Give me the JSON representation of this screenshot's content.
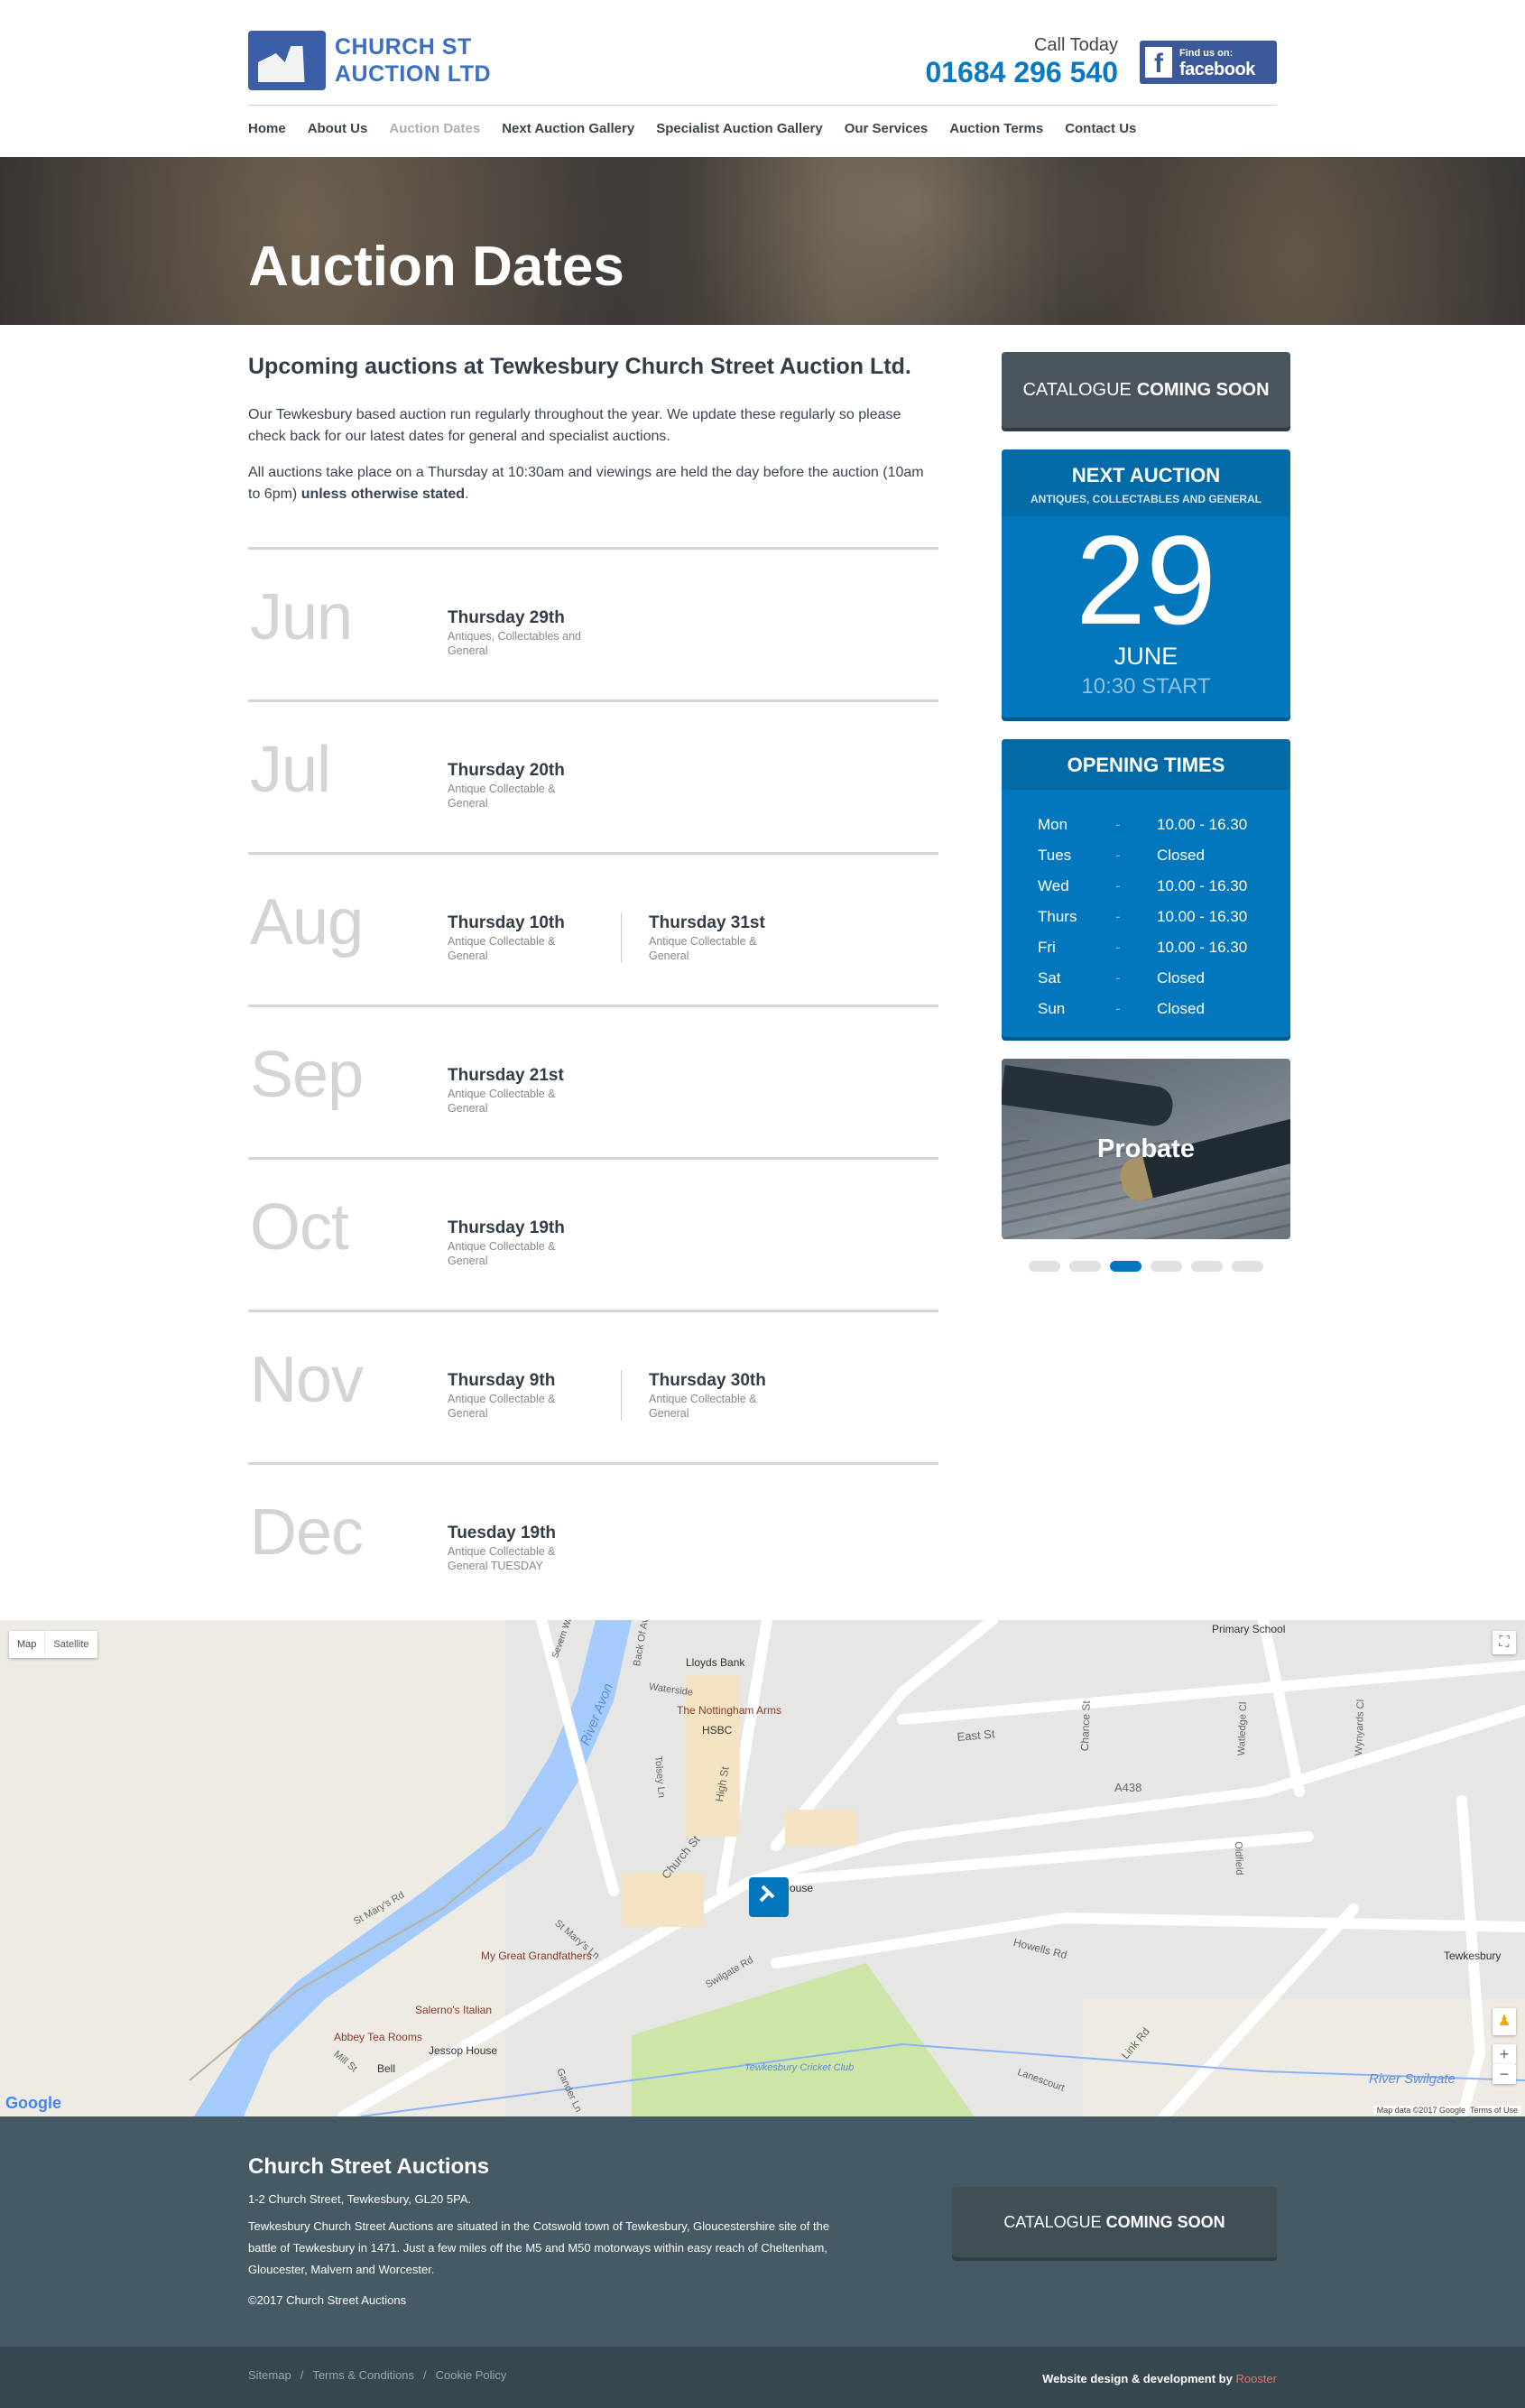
{
  "header": {
    "logo_text_1": "CHURCH ST",
    "logo_text_2": "AUCTION LTD",
    "call_label": "Call Today",
    "phone": "01684 296 540",
    "facebook_line1": "Find us on:",
    "facebook_line2": "facebook"
  },
  "nav": [
    {
      "label": "Home"
    },
    {
      "label": "About Us"
    },
    {
      "label": "Auction Dates",
      "active": true
    },
    {
      "label": "Next Auction Gallery"
    },
    {
      "label": "Specialist Auction Gallery"
    },
    {
      "label": "Our Services"
    },
    {
      "label": "Auction Terms"
    },
    {
      "label": "Contact Us"
    }
  ],
  "hero": {
    "title": "Auction Dates"
  },
  "intro": {
    "heading": "Upcoming auctions at Tewkesbury Church Street Auction Ltd.",
    "para1": "Our Tewkesbury based auction run regularly throughout the year. We update these regularly so please check back for our latest dates for general and specialist auctions.",
    "para2_start": "All auctions take place on a Thursday at 10:30am and viewings are held the day before the auction (10am to 6pm) ",
    "para2_bold": "unless otherwise stated",
    "para2_end": "."
  },
  "months": [
    {
      "month": "Jun",
      "dates": [
        {
          "day": "Thursday 29th",
          "desc": "Antiques, Collectables and General"
        }
      ]
    },
    {
      "month": "Jul",
      "dates": [
        {
          "day": "Thursday 20th",
          "desc": "Antique Collectable & General"
        }
      ]
    },
    {
      "month": "Aug",
      "dates": [
        {
          "day": "Thursday 10th",
          "desc": "Antique Collectable & General"
        },
        {
          "day": "Thursday 31st",
          "desc": "Antique Collectable & General"
        }
      ]
    },
    {
      "month": "Sep",
      "dates": [
        {
          "day": "Thursday 21st",
          "desc": "Antique Collectable & General"
        }
      ]
    },
    {
      "month": "Oct",
      "dates": [
        {
          "day": "Thursday 19th",
          "desc": "Antique Collectable & General"
        }
      ]
    },
    {
      "month": "Nov",
      "dates": [
        {
          "day": "Thursday 9th",
          "desc": "Antique Collectable & General"
        },
        {
          "day": "Thursday 30th",
          "desc": "Antique Collectable & General"
        }
      ]
    },
    {
      "month": "Dec",
      "dates": [
        {
          "day": "Tuesday 19th",
          "desc": "Antique Collectable & General TUESDAY"
        }
      ]
    }
  ],
  "sidebar": {
    "catalogue_normal": "CATALOGUE",
    "catalogue_bold": "COMING SOON",
    "next_auction": {
      "title": "NEXT AUCTION",
      "subtitle": "ANTIQUES, COLLECTABLES AND GENERAL",
      "day": "29",
      "month": "JUNE",
      "start": "10:30 START"
    },
    "opening": {
      "title": "OPENING TIMES",
      "rows": [
        {
          "day": "Mon",
          "hours": "10.00 - 16.30"
        },
        {
          "day": "Tues",
          "hours": "Closed"
        },
        {
          "day": "Wed",
          "hours": "10.00 - 16.30"
        },
        {
          "day": "Thurs",
          "hours": "10.00 - 16.30"
        },
        {
          "day": "Fri",
          "hours": "10.00 - 16.30"
        },
        {
          "day": "Sat",
          "hours": "Closed"
        },
        {
          "day": "Sun",
          "hours": "Closed"
        }
      ],
      "dash": "-"
    },
    "slider": {
      "label": "Probate",
      "slide_count": 6,
      "active_index": 2
    }
  },
  "map": {
    "type_map": "Map",
    "type_satellite": "Satellite",
    "attribution": "Map data ©2017 Google",
    "terms": "Terms of Use",
    "google": "Google",
    "labels": [
      "River Avon",
      "Severn Way",
      "Lloyds Bank",
      "Waterside",
      "The Nottingham Arms",
      "HSBC",
      "East St",
      "A438",
      "Chance St",
      "Watledge Cl",
      "Wynyards Cl",
      "Oldfield",
      "Primary School",
      "Tewkesbury",
      "Howells Rd",
      "Link Rd",
      "Lanescourt",
      "River Swilgate",
      "Swilgate Rd",
      "Church St",
      "High St",
      "St Mary's Rd",
      "St Mary's Ln",
      "My Great Grandfathers",
      "Salerno's Italian",
      "Abbey Tea Rooms",
      "Jessop House",
      "Bell",
      "Mill St",
      "Gander Ln",
      "Tewkesbury Cricket Club",
      "Back Of Avon",
      "Tolsey Ln",
      "ouse"
    ]
  },
  "footer": {
    "title": "Church Street Auctions",
    "address": "1-2 Church Street, Tewkesbury, GL20 5PA.",
    "description": "Tewkesbury Church Street Auctions are situated in the Cotswold town of Tewkesbury, Gloucestershire site of the battle of Tewkesbury in 1471. Just a few miles off the M5 and M50 motorways within easy reach of Cheltenham, Gloucester, Malvern and Worcester.",
    "copyright": "©2017 Church Street Auctions",
    "catalogue_normal": "CATALOGUE",
    "catalogue_bold": "COMING SOON"
  },
  "bottom": {
    "links": [
      "Sitemap",
      "Terms & Conditions",
      "Cookie Policy"
    ],
    "separator": "/",
    "credit": "Website design & development by",
    "credit_link": "Rooster"
  },
  "colors": {
    "brand_blue": "#0277bd",
    "dark_slate": "#455a64",
    "bottom_bar": "#37474f",
    "rooster": "#e57368"
  }
}
